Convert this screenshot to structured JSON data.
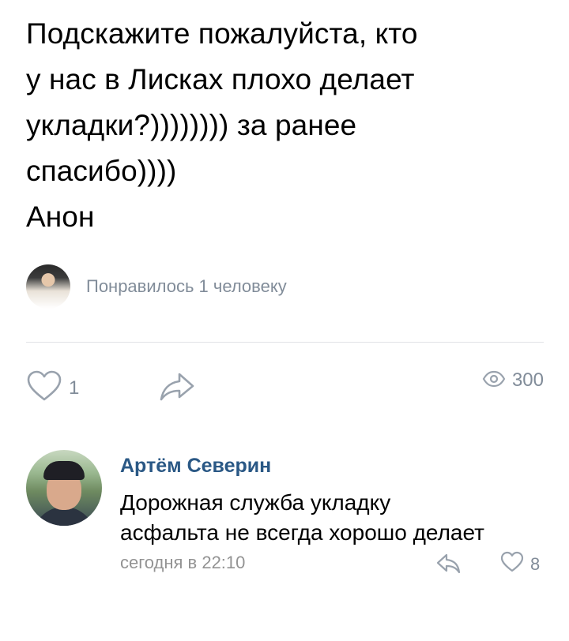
{
  "post": {
    "text_lines": [
      "Подскажите пожалуйста, кто",
      "у нас в Лисках плохо делает",
      "укладки?)))))))) за ранее",
      "спасибо))))",
      "Анон"
    ]
  },
  "likers": {
    "text": "Понравилось 1 человеку"
  },
  "actions": {
    "like_count": "1",
    "views_count": "300",
    "like_icon": "heart-outline-icon",
    "share_icon": "share-arrow-icon",
    "views_icon": "eye-icon"
  },
  "comment": {
    "author": "Артём Северин",
    "text_lines": [
      "Дорожная служба укладку",
      "асфальта не всегда хорошо делает"
    ],
    "time": "сегодня в 22:10",
    "like_count": "8",
    "reply_icon": "reply-arrow-icon"
  },
  "colors": {
    "link": "#2a5885",
    "secondary": "#818c99",
    "icon": "#99a2ad",
    "divider": "#e1e3e6"
  }
}
